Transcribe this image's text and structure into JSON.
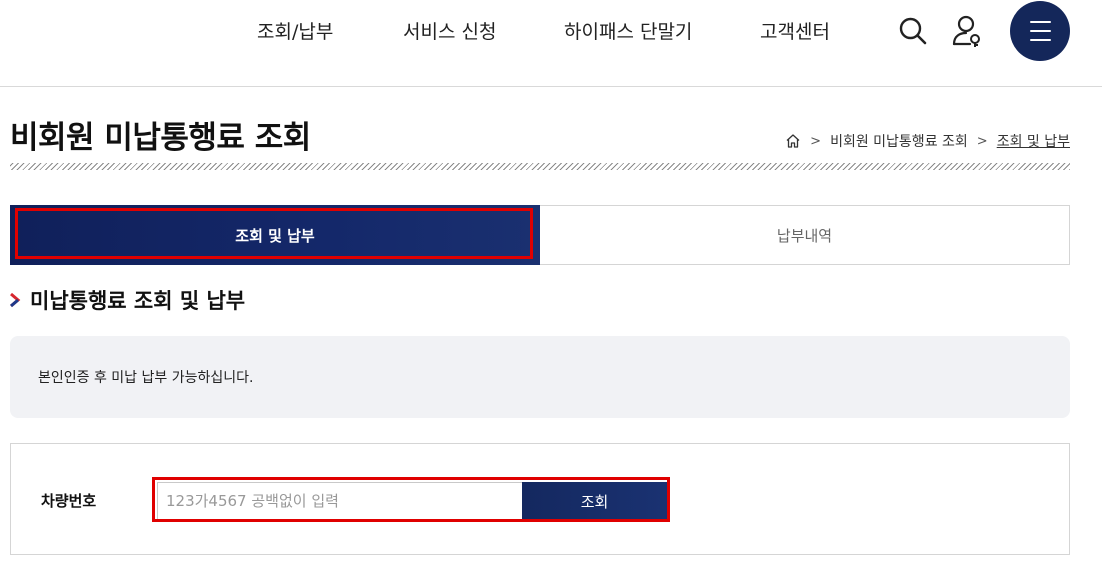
{
  "header": {
    "nav": [
      "조회/납부",
      "서비스 신청",
      "하이패스 단말기",
      "고객센터"
    ],
    "icons": [
      "search-icon",
      "user-login-icon",
      "menu-icon"
    ],
    "brand_color": "#14275a"
  },
  "page": {
    "title": "비회원 미납통행료 조회",
    "breadcrumb": [
      "비회원 미납통행료 조회",
      "조회 및 납부"
    ]
  },
  "tabs": [
    {
      "label": "조회 및 납부",
      "active": true
    },
    {
      "label": "납부내역",
      "active": false
    }
  ],
  "section": {
    "title": "미납통행료 조회 및 납부",
    "notice": "본인인증 후 미납 납부 가능하십니다."
  },
  "form": {
    "label": "차량번호",
    "placeholder": "123가4567 공백없이 입력",
    "value": "",
    "button": "조회"
  },
  "highlight_color": "#e00000"
}
